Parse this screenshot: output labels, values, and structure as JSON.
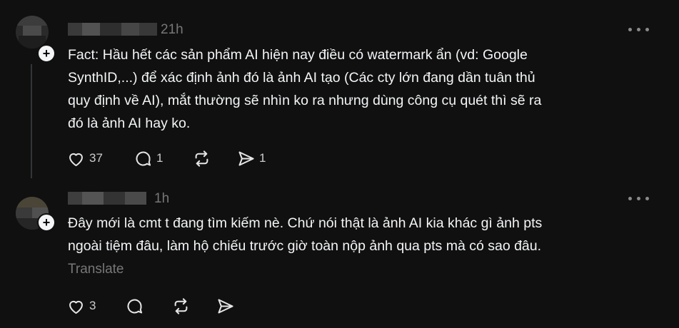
{
  "posts": [
    {
      "time": "21h",
      "text": "Fact: Hầu hết các sản phẩm AI hiện nay điều có watermark ẩn (vd: Google\nSynthID,...) để xác định ảnh đó là ảnh AI tạo (Các cty lớn đang dần tuân thủ\nquy định về AI), mắt thường sẽ nhìn ko ra nhưng dùng công cụ quét thì sẽ ra\nđó là ảnh AI hay ko.",
      "likes": "37",
      "comments": "1",
      "shares": "1",
      "follow_symbol": "+"
    },
    {
      "time": "1h",
      "text": "Đây mới là cmt t đang tìm kiếm nè. Chứ nói thật là ảnh AI kia khác gì ảnh pts\nngoài tiệm đâu, làm hộ chiếu trước giờ toàn nộp ảnh qua pts mà có sao đâu.",
      "translate_label": "Translate",
      "likes": "3",
      "follow_symbol": "+"
    }
  ],
  "icons": [
    "more-icon",
    "heart-icon",
    "comment-icon",
    "repost-icon",
    "share-icon",
    "plus-icon"
  ],
  "colors": {
    "background": "#101010",
    "text": "#f3f5f7",
    "muted": "#777777",
    "thread_line": "#333638"
  }
}
